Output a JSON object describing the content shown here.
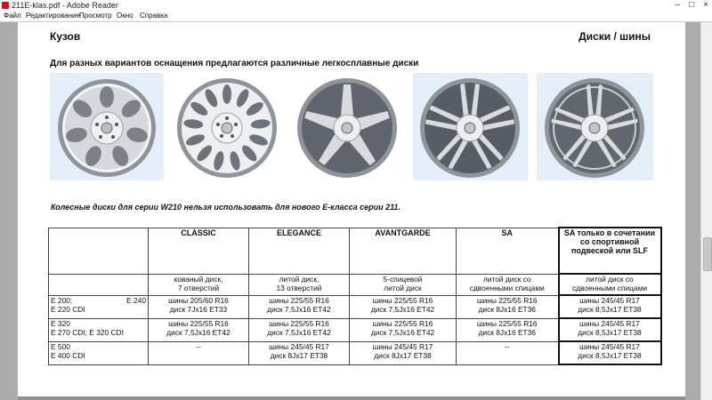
{
  "window": {
    "title": "211E-klas.pdf - Adobe Reader",
    "minimize": "–",
    "maximize": "□",
    "close": "×"
  },
  "menu": [
    "Файл",
    "Редактирование",
    "Просмотр",
    "Окно",
    "Справка"
  ],
  "document": {
    "header_left": "Кузов",
    "header_right": "Диски / шины",
    "intro": "Для разных вариантов оснащения предлагаются различные легкосплавные диски",
    "note": "Колесные диски для серии W210 нельзя использовать для нового Е-класса серии 211.",
    "wheel_images": [
      "wheel-7-hole-icon",
      "wheel-13-hole-icon",
      "wheel-5-spoke-icon",
      "wheel-double-spoke-icon",
      "wheel-sport-double-spoke-icon"
    ],
    "table": {
      "headers": [
        "",
        "CLASSIC",
        "ELEGANCE",
        "AVANTGARDE",
        "SA",
        "SA только в сочетании со спортивной подвеской или SLF"
      ],
      "descriptions": [
        "",
        [
          "кованый диск,",
          "7 отверстий"
        ],
        [
          "литой диск,",
          "13 отверстий"
        ],
        [
          "5-спицевой",
          "литой диск"
        ],
        [
          "литой диск со",
          "сдвоенными спицами"
        ],
        [
          "литой диск со",
          "сдвоенными спицами"
        ]
      ],
      "rows": [
        {
          "model_a": "E 200;",
          "model_b": "E 240",
          "model_c": "E 220 CDI",
          "cells": [
            [
              "шины 205/60 R16",
              "диск 7Jx16     ET33"
            ],
            [
              "шины 225/55 R16",
              "диск 7,5Jx16    ET42"
            ],
            [
              "шины 225/55 R16",
              "диск 7,5Jx16    ET42"
            ],
            [
              "шины 225/55 R16",
              "диск 8Jx16     ET36"
            ],
            [
              "шины 245/45 R17",
              "диск 8,5Jx17    ET38"
            ]
          ]
        },
        {
          "model_a": "E 320",
          "model_b": "",
          "model_c": "E 270 CDI; E 320 CDI",
          "cells": [
            [
              "шины 225/55 R16",
              "диск 7,5Jx16    ET42"
            ],
            [
              "шины 225/55 R16",
              "диск 7,5Jx16    ET42"
            ],
            [
              "шины 225/55 R16",
              "диск 7,5Jx16    ET42"
            ],
            [
              "шины 225/55 R16",
              "диск 8Jx16     ET36"
            ],
            [
              "шины 245/45 R17",
              "диск 8,5Jx17    ET38"
            ]
          ]
        },
        {
          "model_a": "E 500",
          "model_b": "",
          "model_c": "E 400 CDI",
          "cells": [
            [
              "--",
              ""
            ],
            [
              "шины 245/45 R17",
              "диск 8Jx17     ET38"
            ],
            [
              "шины 245/45 R17",
              "диск 8Jx17     ET38"
            ],
            [
              "--",
              ""
            ],
            [
              "шины 245/45 R17",
              "диск 8,5Jx17    ET38"
            ]
          ]
        }
      ]
    }
  }
}
